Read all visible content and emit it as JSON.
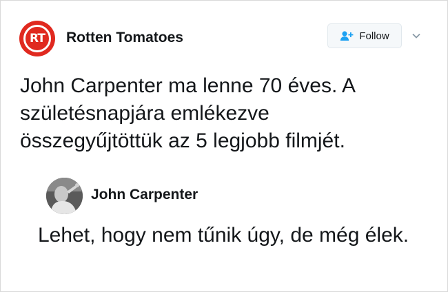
{
  "header": {
    "avatar_text": "RT",
    "account_name": "Rotten Tomatoes",
    "follow_label": "Follow",
    "brand_color": "#e0291f",
    "follow_icon": "add-user-icon",
    "menu_icon": "chevron-down-icon"
  },
  "tweet": {
    "lines": [
      "John Carpenter ma lenne 70 éves. A",
      "születésnapjára emlékezve",
      "összegyűjtöttük az 5 legjobb filmjét."
    ]
  },
  "quote": {
    "name": "John Carpenter",
    "text": "Lehet, hogy nem tűnik úgy, de még élek."
  }
}
